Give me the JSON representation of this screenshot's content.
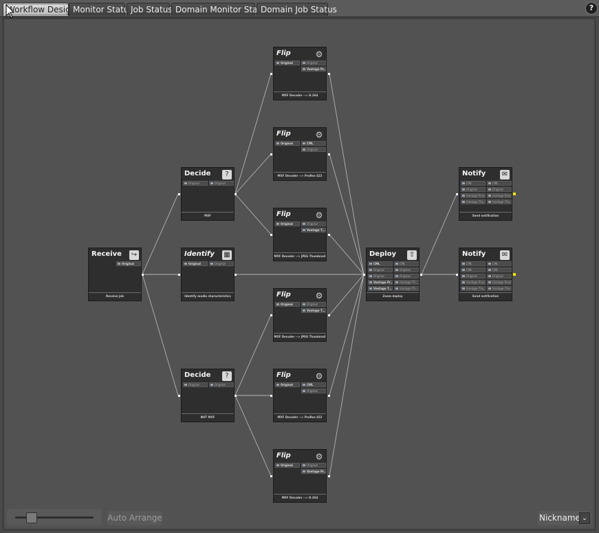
{
  "tabs": [
    {
      "label": "Workflow Design",
      "active": true
    },
    {
      "label": "Monitor Status"
    },
    {
      "label": "Job Status"
    },
    {
      "label": "Domain Monitor Status"
    },
    {
      "label": "Domain Job Status"
    }
  ],
  "help_label": "?",
  "nodes": {
    "receive": {
      "title": "Receive",
      "icon": "receive-icon",
      "ports": [
        "Original"
      ],
      "footer": "Receive job"
    },
    "decide_mxf": {
      "title": "Decide",
      "icon": "decide-icon",
      "ports": [
        "Original",
        "Original"
      ],
      "footer": "MXF"
    },
    "identify": {
      "title": "Identify",
      "icon": "identify-icon",
      "ports": [
        "Original",
        "Original"
      ],
      "footer": "Identify media characteristics"
    },
    "decide_not_mxf": {
      "title": "Decide",
      "icon": "decide-icon",
      "ports": [
        "Original",
        "Original"
      ],
      "footer": "NOT MXF"
    },
    "flip1": {
      "title": "Flip",
      "icon": "gear-icon",
      "ports": [
        "Original",
        "Original",
        "Vantage Pr..."
      ],
      "footer": "MXF Decoder --> H.264"
    },
    "flip2": {
      "title": "Flip",
      "icon": "gear-icon",
      "ports": [
        "Original",
        "CML",
        "Original"
      ],
      "footer": "MXF Decoder --> ProRes 422"
    },
    "flip3": {
      "title": "Flip",
      "icon": "gear-icon",
      "ports": [
        "Original",
        "Original",
        "Vantage T..."
      ],
      "footer": "MXF Decoder --> JPEG Thumbnail"
    },
    "flip4": {
      "title": "Flip",
      "icon": "gear-icon",
      "ports": [
        "Original",
        "Original",
        "Vantage T..."
      ],
      "footer": "MXF Decoder --> JPEG Thumbnail"
    },
    "flip5": {
      "title": "Flip",
      "icon": "gear-icon",
      "ports": [
        "Original",
        "CML",
        "Original"
      ],
      "footer": "MXF Decoder --> ProRes 422"
    },
    "flip6": {
      "title": "Flip",
      "icon": "gear-icon",
      "ports": [
        "Original",
        "Original",
        "Vantage Pr..."
      ],
      "footer": "MXF Decoder --> H.264"
    },
    "deploy": {
      "title": "Deploy",
      "icon": "deploy-icon",
      "ports_left": [
        "CML",
        "Original",
        "Original",
        "Vantage Pr...",
        "Vantage T..."
      ],
      "ports_right": [
        "CML",
        "Original",
        "Original",
        "Vantage Th...",
        "Vantage Th..."
      ],
      "footer": "Zoom deploy"
    },
    "notify1": {
      "title": "Notify",
      "icon": "notify-icon",
      "ports_left": [
        "CML",
        "Original",
        "Vantage Prox",
        "Vantage Thu..."
      ],
      "ports_right": [
        "CML",
        "Original",
        "Vantage Prox",
        "Vantage Thu..."
      ],
      "footer": "Send notification"
    },
    "notify2": {
      "title": "Notify",
      "icon": "notify-icon",
      "ports_left": [
        "CML",
        "CML",
        "Original",
        "Vantage Prox",
        "Vantage Thu..."
      ],
      "ports_right": [
        "CML",
        "CML",
        "Original",
        "Vantage Prox",
        "Vantage Thu..."
      ],
      "footer": "Send notification"
    }
  },
  "zoom": {
    "level": 0.16
  },
  "auto_arrange_label": "Auto Arrange",
  "nicknames": {
    "label": "Nicknames",
    "chevron": "⌄"
  }
}
